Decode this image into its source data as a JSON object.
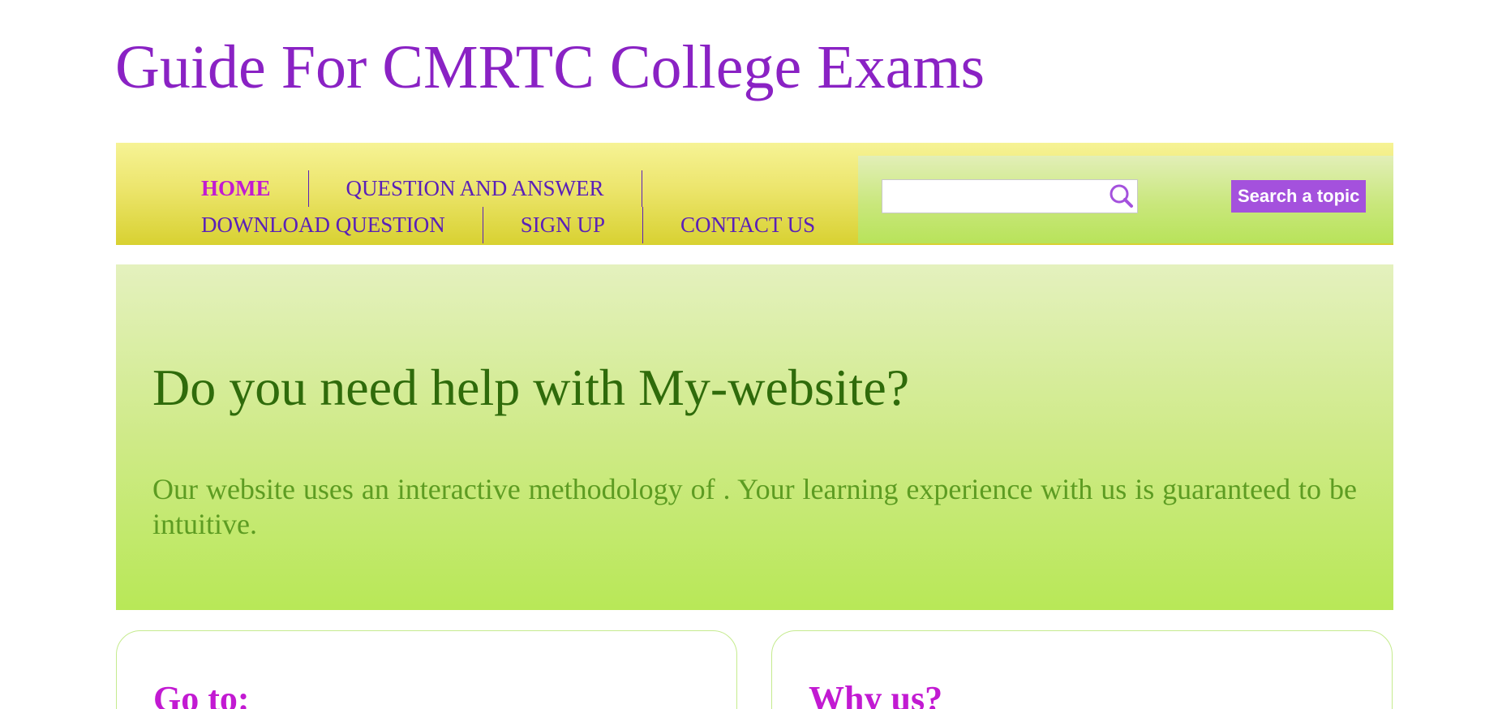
{
  "site": {
    "title": "Guide For CMRTC College Exams"
  },
  "nav": {
    "items": [
      {
        "label": "HOME",
        "active": true
      },
      {
        "label": "QUESTION AND ANSWER",
        "active": false
      },
      {
        "label": "DOWNLOAD QUESTION",
        "active": false
      },
      {
        "label": "SIGN UP",
        "active": false
      },
      {
        "label": "CONTACT US",
        "active": false
      }
    ]
  },
  "search": {
    "value": "",
    "icon": "search-icon",
    "button_label": "Search a topic"
  },
  "hero": {
    "title": "Do you need help with My-website?",
    "text": "Our website uses an interactive methodology of . Your learning experience with us is guaranteed to be intuitive."
  },
  "cards": [
    {
      "heading": "Go to:"
    },
    {
      "heading": "Why us?"
    }
  ],
  "colors": {
    "brand_purple": "#8a22c4",
    "nav_text": "#5a20b8",
    "nav_active": "#c21ad2",
    "button_bg": "#a451dd",
    "hero_title": "#2f6b0b",
    "hero_text": "#5d9c22"
  }
}
